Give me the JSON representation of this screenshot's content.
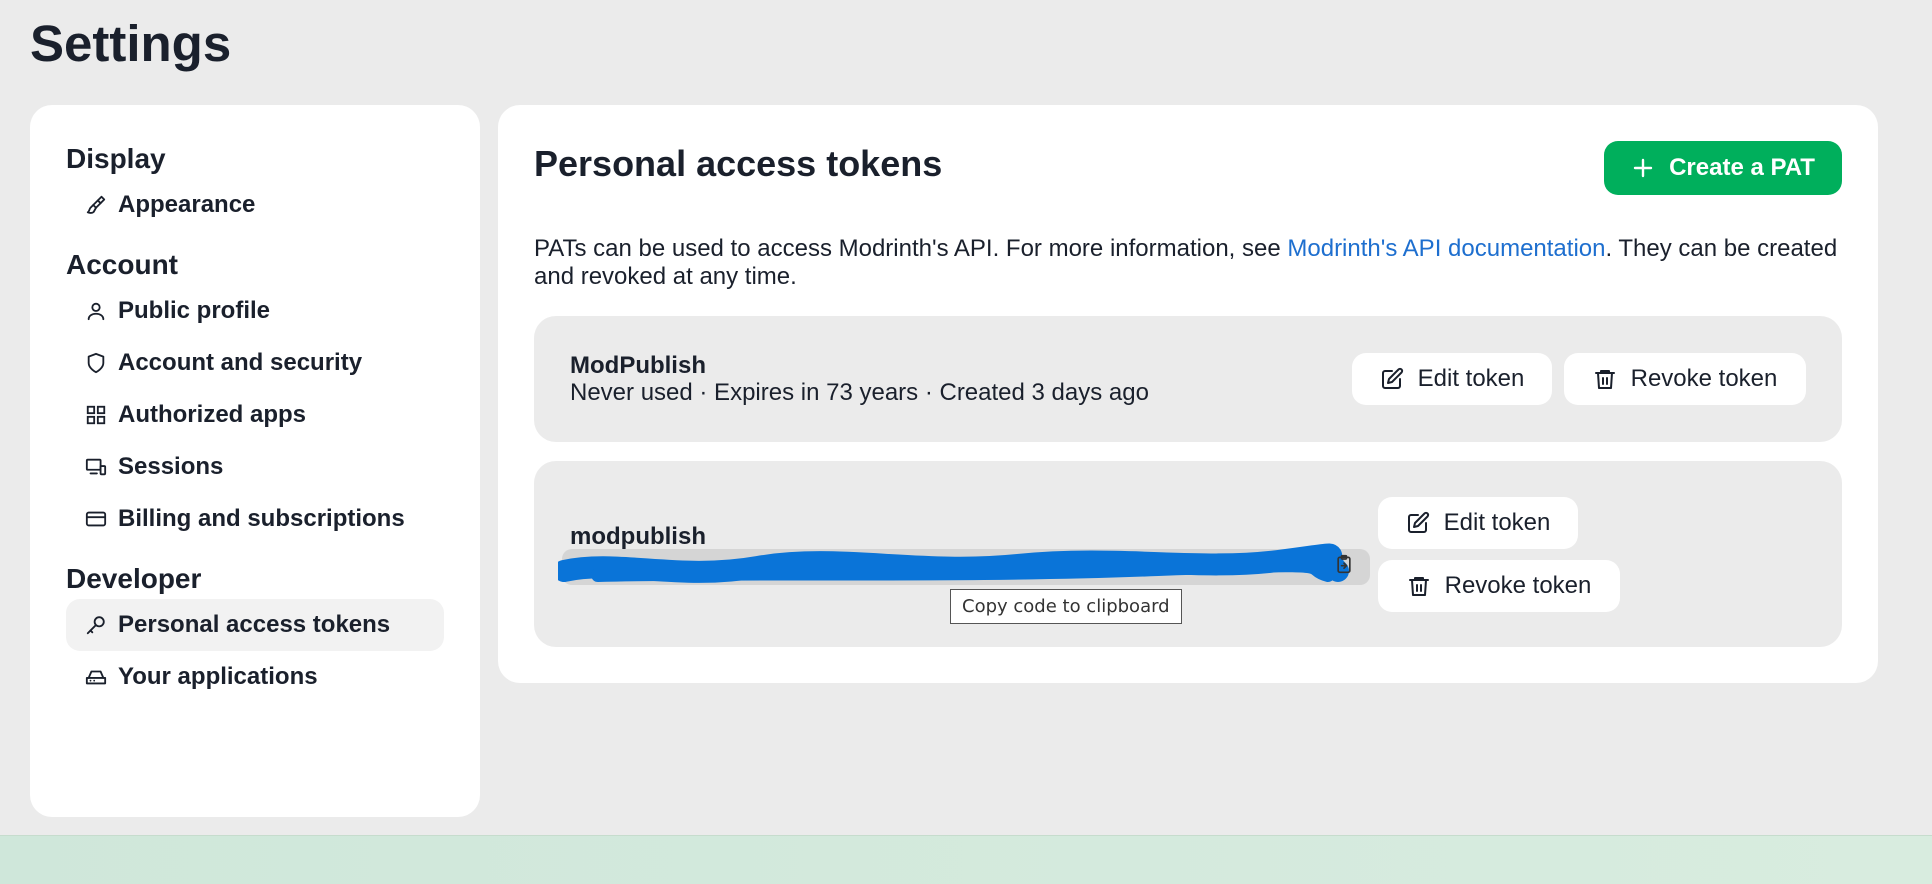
{
  "page": {
    "title": "Settings"
  },
  "sidebar": {
    "groups": [
      {
        "heading": "Display",
        "items": [
          {
            "label": "Appearance",
            "icon": "paintbrush-icon"
          }
        ]
      },
      {
        "heading": "Account",
        "items": [
          {
            "label": "Public profile",
            "icon": "user-icon"
          },
          {
            "label": "Account and security",
            "icon": "shield-icon"
          },
          {
            "label": "Authorized apps",
            "icon": "grid-icon"
          },
          {
            "label": "Sessions",
            "icon": "monitor-icon"
          },
          {
            "label": "Billing and subscriptions",
            "icon": "card-icon"
          }
        ]
      },
      {
        "heading": "Developer",
        "items": [
          {
            "label": "Personal access tokens",
            "icon": "key-icon",
            "active": true
          },
          {
            "label": "Your applications",
            "icon": "drive-icon"
          }
        ]
      }
    ]
  },
  "main": {
    "title": "Personal access tokens",
    "create_label": "Create a PAT",
    "desc_before": "PATs can be used to access Modrinth's API. For more information, see ",
    "desc_link": "Modrinth's API documentation",
    "desc_after": ". They can be created and revoked at any time.",
    "tokens": [
      {
        "name": "ModPublish",
        "meta": "Never used · Expires in 73 years · Created 3 days ago",
        "edit_label": "Edit token",
        "revoke_label": "Revoke token"
      },
      {
        "name": "modpublish",
        "edit_label": "Edit token",
        "revoke_label": "Revoke token"
      }
    ]
  },
  "tooltip": {
    "text": "Copy code to clipboard"
  },
  "colors": {
    "accent": "#00af5c",
    "link": "#1e6fcf",
    "redaction": "#0a74d8"
  }
}
